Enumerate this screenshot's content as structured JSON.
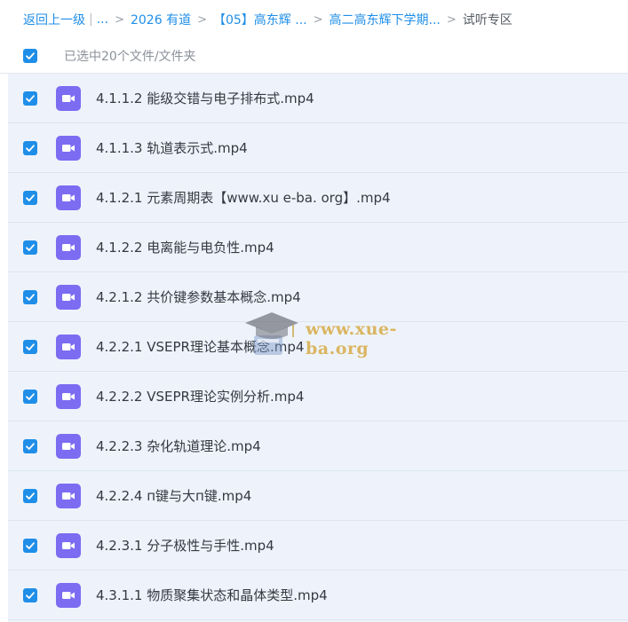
{
  "breadcrumb": {
    "back": "返回上一级",
    "sep": "|",
    "ellipsis": "...",
    "arrow": ">",
    "items": [
      "2026 有道",
      "【05】高东辉 ...",
      "高二高东辉下学期..."
    ],
    "current": "试听专区"
  },
  "selection": {
    "label": "已选中20个文件/文件夹"
  },
  "files": [
    {
      "name": "4.1.1.2 能级交错与电子排布式.mp4"
    },
    {
      "name": "4.1.1.3 轨道表示式.mp4"
    },
    {
      "name": "4.1.2.1 元素周期表【www.xu e-ba. org】.mp4"
    },
    {
      "name": "4.1.2.2 电离能与电负性.mp4"
    },
    {
      "name": "4.2.1.2 共价键参数基本概念.mp4"
    },
    {
      "name": "4.2.2.1 VSEPR理论基本概念.mp4"
    },
    {
      "name": "4.2.2.2 VSEPR理论实例分析.mp4"
    },
    {
      "name": "4.2.2.3 杂化轨道理论.mp4"
    },
    {
      "name": "4.2.2.4 п键与大п键.mp4"
    },
    {
      "name": "4.2.3.1 分子极性与手性.mp4"
    },
    {
      "name": "4.3.1.1 物质聚集状态和晶体类型.mp4"
    }
  ],
  "watermark": {
    "text": "www.xue-ba.org"
  },
  "colors": {
    "accent": "#1f8ee8",
    "video_icon": "#7b6cf2",
    "list_bg": "#eef3fb"
  }
}
